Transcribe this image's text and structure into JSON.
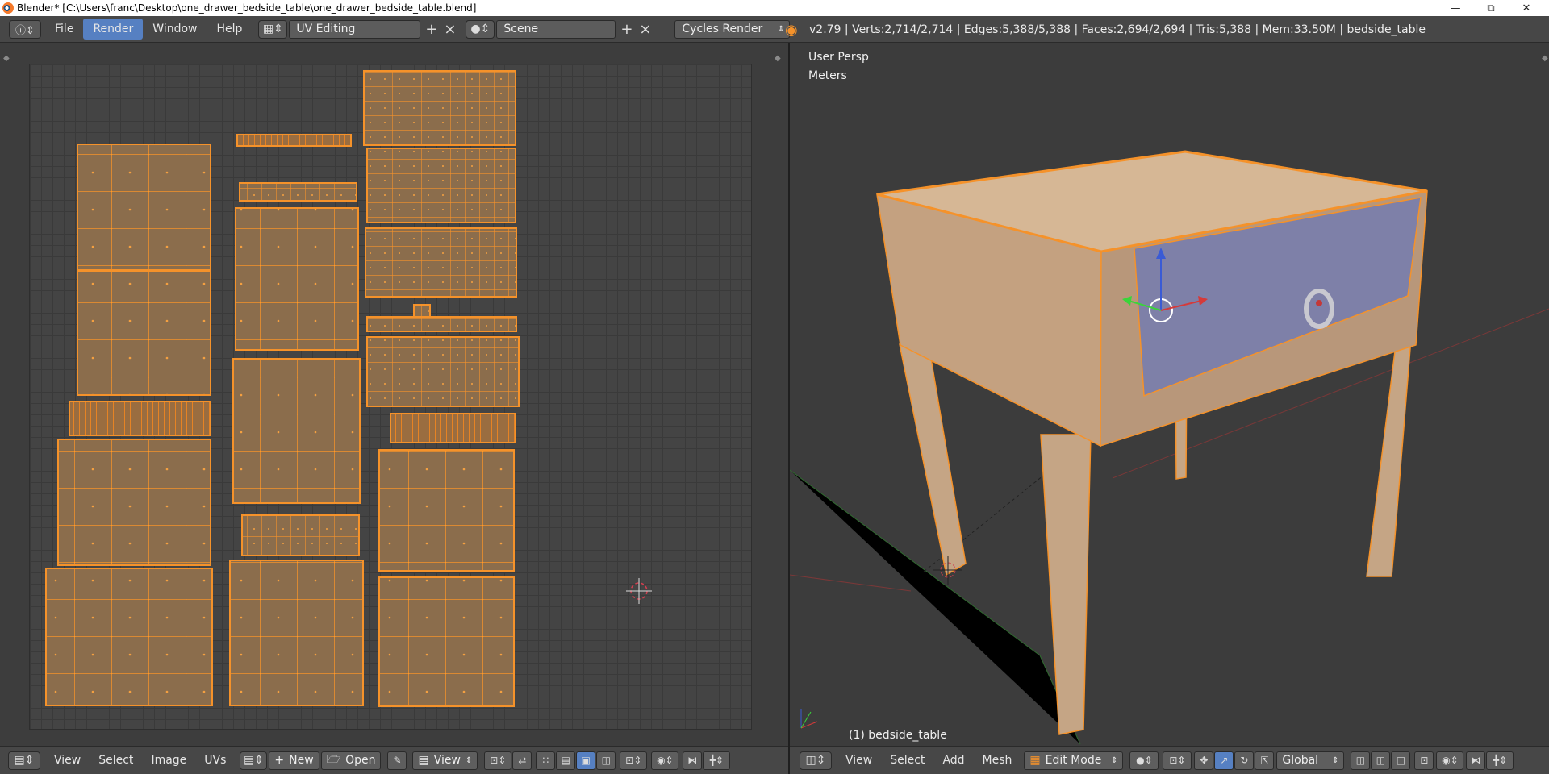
{
  "window": {
    "title": "Blender* [C:\\Users\\franc\\Desktop\\one_drawer_bedside_table\\one_drawer_bedside_table.blend]"
  },
  "info_header": {
    "menus": [
      "File",
      "Render",
      "Window",
      "Help"
    ],
    "active_menu": "Render",
    "screen_layout": "UV Editing",
    "scene": "Scene",
    "render_engine": "Cycles Render",
    "stats": "v2.79 | Verts:2,714/2,714 | Edges:5,388/5,388 | Faces:2,694/2,694 | Tris:5,388 | Mem:33.50M | bedside_table"
  },
  "uv_editor": {
    "footer": {
      "menus": [
        "View",
        "Select",
        "Image",
        "UVs"
      ],
      "new_label": "New",
      "open_label": "Open",
      "view_label": "View"
    }
  },
  "viewport": {
    "view_name": "User Persp",
    "units": "Meters",
    "object_label": "(1) bedside_table",
    "footer": {
      "menus": [
        "View",
        "Select",
        "Add",
        "Mesh"
      ],
      "mode": "Edit Mode",
      "orientation": "Global"
    }
  },
  "colors": {
    "accent": "#5680c2",
    "selection": "#f5922a",
    "uv_face": "#8b6d4c",
    "mesh_face": "#c5a585",
    "drawer": "#7a7ca8"
  }
}
